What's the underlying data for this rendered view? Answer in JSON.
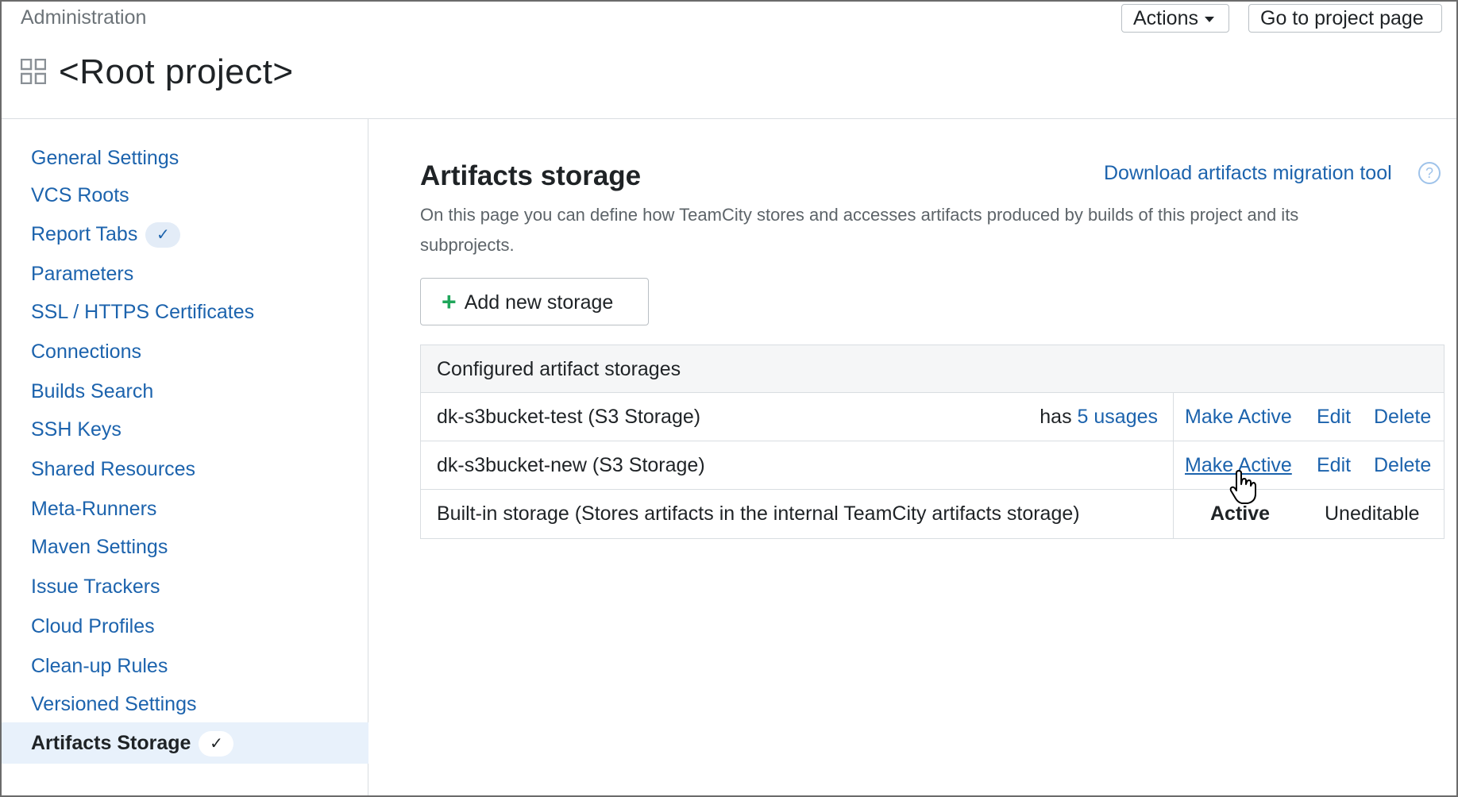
{
  "header": {
    "breadcrumb": "Administration",
    "project_title": "<Root project>",
    "actions_label": "Actions",
    "goto_label": "Go to project page"
  },
  "sidebar": {
    "items": [
      {
        "label": "General Settings"
      },
      {
        "label": "VCS Roots"
      },
      {
        "label": "Report Tabs",
        "check": "✓"
      },
      {
        "label": "Parameters"
      },
      {
        "label": "SSL / HTTPS Certificates"
      },
      {
        "label": "Connections"
      },
      {
        "label": "Builds Search"
      },
      {
        "label": "SSH Keys"
      },
      {
        "label": "Shared Resources"
      },
      {
        "label": "Meta-Runners"
      },
      {
        "label": "Maven Settings"
      },
      {
        "label": "Issue Trackers"
      },
      {
        "label": "Cloud Profiles"
      },
      {
        "label": "Clean-up Rules"
      },
      {
        "label": "Versioned Settings"
      },
      {
        "label": "Artifacts Storage",
        "check": "✓",
        "selected": true
      }
    ]
  },
  "main": {
    "heading": "Artifacts storage",
    "migration_link": "Download artifacts migration tool",
    "help_icon_glyph": "?",
    "description": "On this page you can define how TeamCity stores and accesses artifacts produced by builds of this project and its subprojects.",
    "add_button_icon": "+",
    "add_button_label": "Add new storage"
  },
  "table": {
    "header": "Configured artifact storages",
    "rows": [
      {
        "name": "dk-s3bucket-test (S3 Storage)",
        "usage_prefix": "has ",
        "usage_link": "5 usages",
        "make_active": "Make Active",
        "edit": "Edit",
        "delete": "Delete"
      },
      {
        "name": "dk-s3bucket-new (S3 Storage)",
        "make_active": "Make Active",
        "edit": "Edit",
        "delete": "Delete"
      },
      {
        "name": "Built-in storage (Stores artifacts in the internal TeamCity artifacts storage)",
        "status": "Active",
        "editable": "Uneditable"
      }
    ]
  },
  "colors": {
    "link": "#1c63ad",
    "selected_bg": "#e8f1fb",
    "add_plus": "#1fa65a"
  }
}
